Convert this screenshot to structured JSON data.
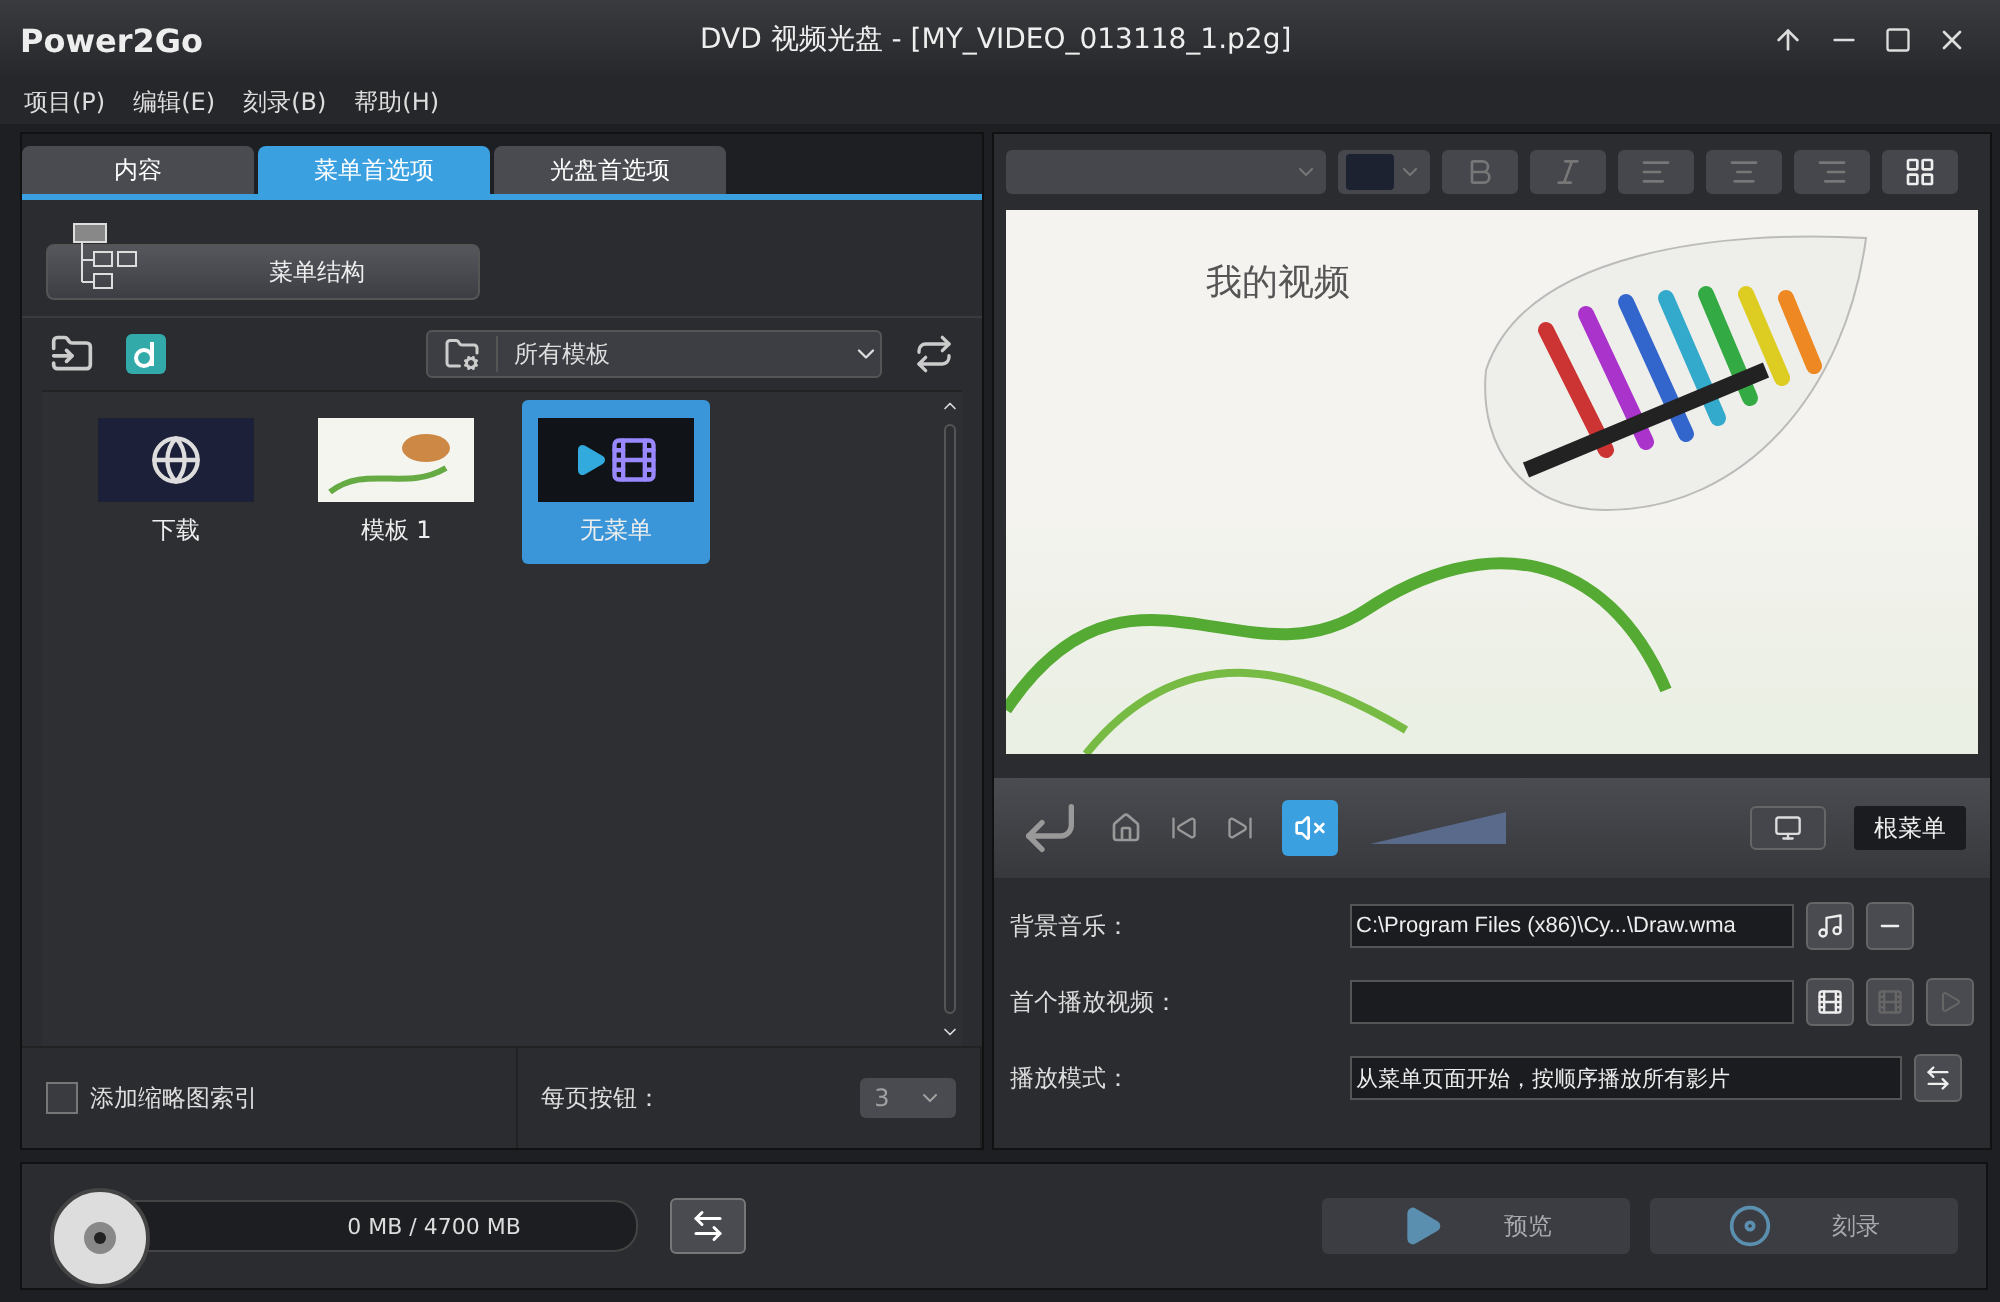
{
  "window": {
    "app_name": "Power2Go",
    "title": "DVD 视频光盘 - [MY_VIDEO_013118_1.p2g]"
  },
  "menu": [
    "项目(P)",
    "编辑(E)",
    "刻录(B)",
    "帮助(H)"
  ],
  "tabs": [
    {
      "label": "内容",
      "selected": false
    },
    {
      "label": "菜单首选项",
      "selected": true
    },
    {
      "label": "光盘首选项",
      "selected": false
    }
  ],
  "menu_structure_button": "菜单结构",
  "template_filter": {
    "value": "所有模板"
  },
  "templates": [
    {
      "label": "下载",
      "kind": "download",
      "selected": false
    },
    {
      "label": "模板 1",
      "kind": "template",
      "selected": false
    },
    {
      "label": "无菜单",
      "kind": "none",
      "selected": true
    }
  ],
  "thumbnail_index": {
    "label": "添加缩略图索引",
    "checked": false
  },
  "buttons_per_page": {
    "label": "每页按钮：",
    "value": "3",
    "disabled": true
  },
  "preview": {
    "title": "我的视频"
  },
  "playback": {
    "muted": true,
    "volume": {
      "level": 1
    },
    "root_menu": "根菜单"
  },
  "settings": [
    {
      "label": "背景音乐：",
      "value": "C:\\Program Files (x86)\\Cy...\\Draw.wma",
      "kind": "music"
    },
    {
      "label": "首个播放视频：",
      "kind": "video"
    },
    {
      "label": "播放模式：",
      "value": "从菜单页面开始，按顺序播放所有影片",
      "kind": "mode"
    }
  ],
  "disc": {
    "usage": "0 MB / 4700 MB"
  },
  "actions": [
    {
      "label": "预览",
      "kind": "preview",
      "disabled": true
    },
    {
      "label": "刻录",
      "kind": "burn",
      "disabled": true
    }
  ]
}
